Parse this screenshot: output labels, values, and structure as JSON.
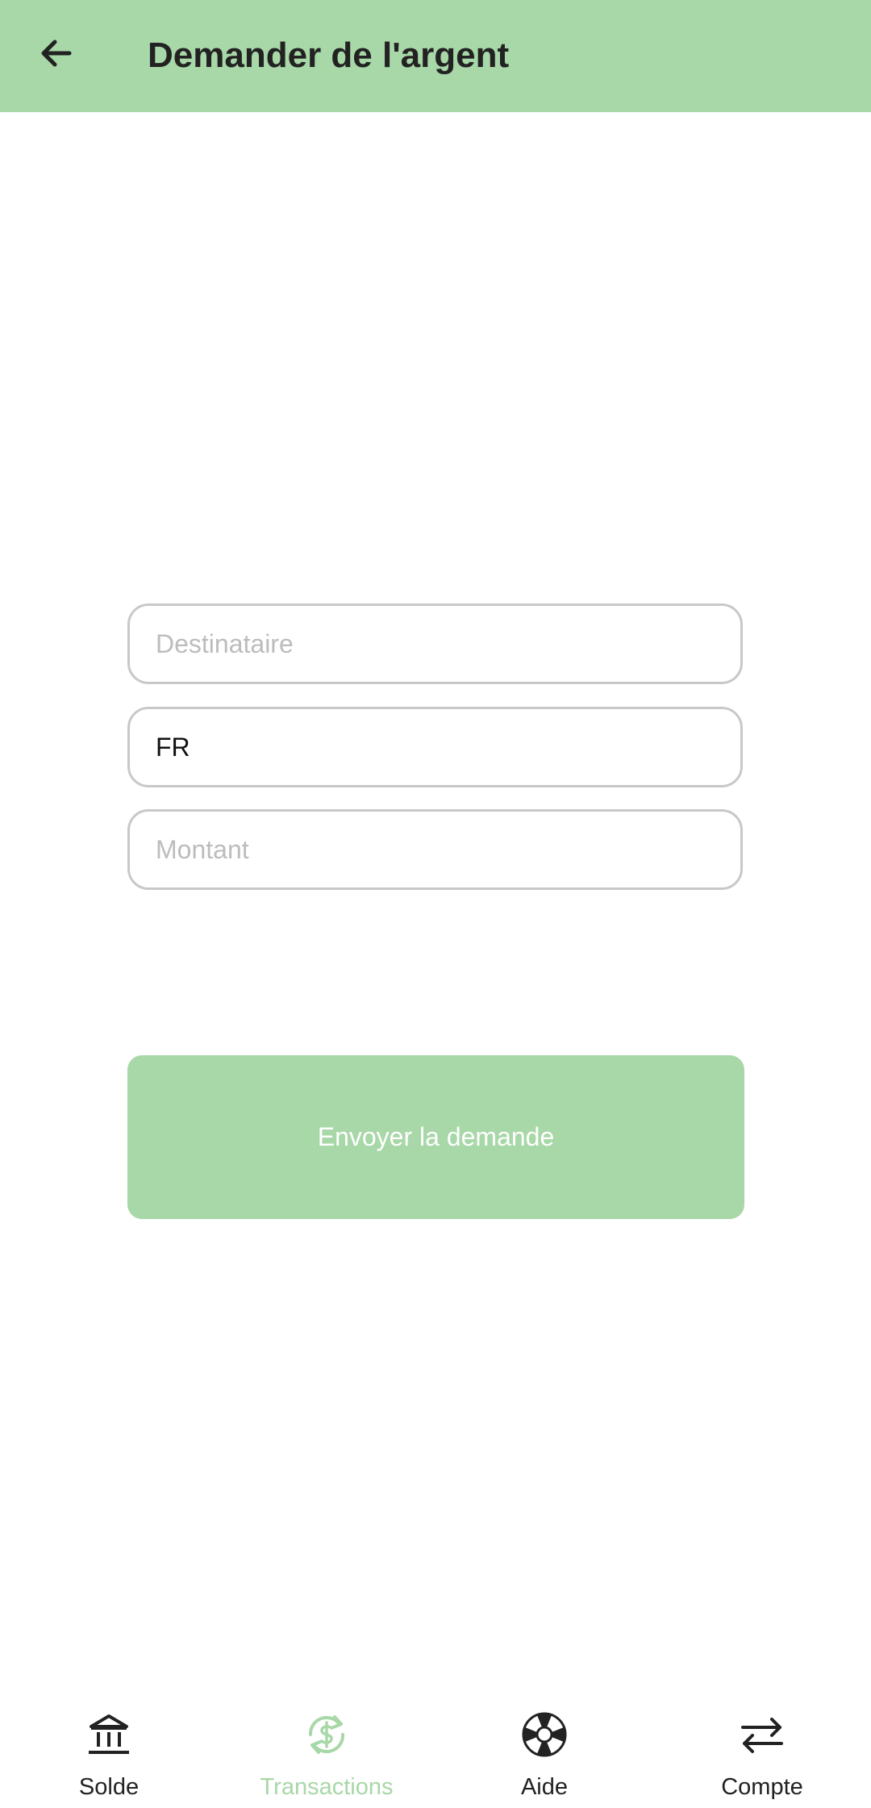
{
  "app_bar": {
    "title": "Demander de l'argent",
    "back_icon": "arrow-left-icon"
  },
  "form": {
    "recipient": {
      "value": "",
      "placeholder": "Destinataire"
    },
    "iban": {
      "value": "FR",
      "placeholder": ""
    },
    "amount": {
      "value": "",
      "placeholder": "Montant"
    },
    "submit_label": "Envoyer la demande"
  },
  "bottom_nav": {
    "items": [
      {
        "label": "Solde",
        "icon": "bank-icon",
        "active": false
      },
      {
        "label": "Transactions",
        "icon": "currency-exchange-icon",
        "active": true
      },
      {
        "label": "Aide",
        "icon": "lifebuoy-icon",
        "active": false
      },
      {
        "label": "Compte",
        "icon": "swap-arrows-icon",
        "active": false
      }
    ]
  },
  "colors": {
    "accent": "#a8d7a8",
    "text_dark": "#222222",
    "field_border": "#c8c8c8",
    "placeholder": "#bcbcbc"
  }
}
